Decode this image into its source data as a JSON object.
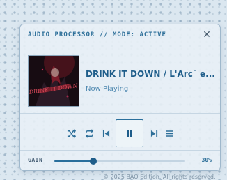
{
  "header": {
    "title": "AUDIO PROCESSOR // MODE: ACTIVE",
    "close_icon": "close-icon"
  },
  "track": {
    "title": "DRINK IT DOWN / L'Arc¯ e...",
    "status": "Now Playing",
    "album_art_logo_text": "DRINK IT DOWN"
  },
  "controls": {
    "icons": [
      "shuffle-icon",
      "repeat-icon",
      "skip-back-icon",
      "pause-icon",
      "skip-forward-icon",
      "menu-icon"
    ],
    "playing": true
  },
  "gain": {
    "label": "GAIN",
    "value_text": "30%",
    "level": 0.3
  },
  "footer": {
    "text": "© 2025 BAO Edition. All rights reserved."
  },
  "colors": {
    "accent": "#2d6f99",
    "title": "#1e5d8a",
    "background": "#dbe7f0"
  }
}
